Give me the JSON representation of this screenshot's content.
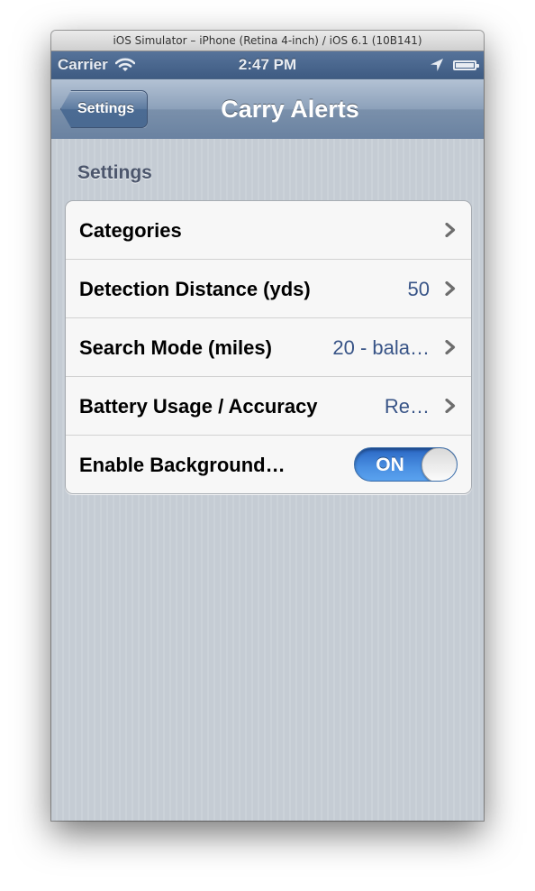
{
  "window": {
    "title": "iOS Simulator – iPhone (Retina 4-inch) / iOS 6.1 (10B141)"
  },
  "status_bar": {
    "carrier": "Carrier",
    "time": "2:47 PM",
    "icons": [
      "wifi-icon",
      "location-arrow-icon",
      "battery-icon"
    ]
  },
  "nav_bar": {
    "back_label": "Settings",
    "title": "Carry Alerts"
  },
  "section": {
    "header": "Settings"
  },
  "rows": [
    {
      "label": "Categories",
      "value": ""
    },
    {
      "label": "Detection Distance (yds)",
      "value": "50"
    },
    {
      "label": "Search Mode (miles)",
      "value": "20 - bala…"
    },
    {
      "label": "Battery Usage / Accuracy",
      "value": "Re…"
    },
    {
      "label": "Enable Background…",
      "toggle": "ON"
    }
  ],
  "colors": {
    "nav_blue": "#6a82a1",
    "value_blue": "#385487",
    "toggle_blue": "#4a90e2",
    "background": "#c5ccd4"
  }
}
